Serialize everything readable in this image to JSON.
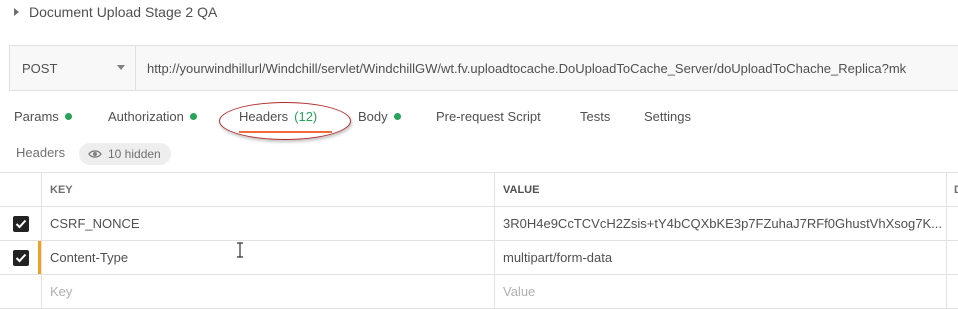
{
  "breadcrumb": {
    "title": "Document Upload Stage 2 QA"
  },
  "request": {
    "method": "POST",
    "url": "http://yourwindhillurl/Windchill/servlet/WindchillGW/wt.fv.uploadtocache.DoUploadToCache_Server/doUploadToChache_Replica?mk"
  },
  "tabs": [
    {
      "label": "Params",
      "dot": true
    },
    {
      "label": "Authorization",
      "dot": true
    },
    {
      "label": "Headers",
      "count": "(12)",
      "active": true
    },
    {
      "label": "Body",
      "dot": true
    },
    {
      "label": "Pre-request Script"
    },
    {
      "label": "Tests"
    },
    {
      "label": "Settings"
    }
  ],
  "headers_section": {
    "label": "Headers",
    "hidden_label": "10 hidden",
    "hidden_icon": "eye-icon"
  },
  "table": {
    "columns": {
      "key": "KEY",
      "value": "VALUE",
      "desc": "D"
    },
    "rows": [
      {
        "checked": true,
        "key": "CSRF_NONCE",
        "value": "3R0H4e9CcTCVcH2Zsis+tY4bCQXbKE3p7FZuhaJ7RFf0GhustVhXsog7K..."
      },
      {
        "checked": true,
        "key": "Content-Type",
        "value": "multipart/form-data",
        "modified": true
      }
    ],
    "placeholder": {
      "key": "Key",
      "value": "Value"
    }
  },
  "colors": {
    "accent": "#f26b3a",
    "dot": "#27a35a",
    "ring": "#b22a2a",
    "modified": "#f0a020"
  }
}
